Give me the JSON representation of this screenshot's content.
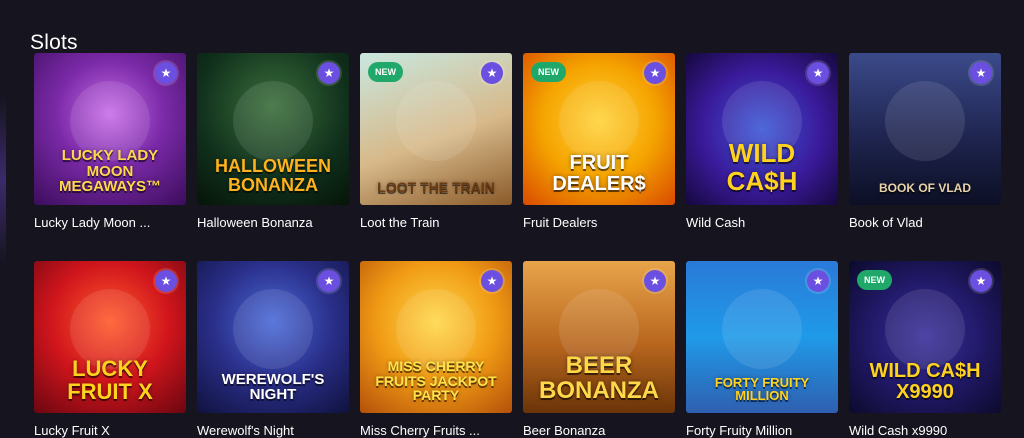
{
  "section": {
    "title": "Slots"
  },
  "games": [
    {
      "name": "Lucky Lady Moon ...",
      "art_text": "Lucky Lady Moon MEGAWAYS™",
      "new": false,
      "title_color": "#ffd84a"
    },
    {
      "name": "Halloween Bonanza",
      "art_text": "HALLOWEEN BONANZA",
      "new": false,
      "title_color": "#ffb21e"
    },
    {
      "name": "Loot the Train",
      "art_text": "Loot the Train",
      "new": true,
      "badge": "NEW",
      "title_color": "#6a3a12"
    },
    {
      "name": "Fruit Dealers",
      "art_text": "FRUIT DEALER$",
      "new": true,
      "badge": "NEW",
      "title_color": "#ffffff"
    },
    {
      "name": "Wild Cash",
      "art_text": "Wild CA$H",
      "new": false,
      "title_color": "#ffd21e"
    },
    {
      "name": "Book of Vlad",
      "art_text": "Book of Vlad",
      "new": false,
      "title_color": "#e8d2a8"
    },
    {
      "name": "Lucky Fruit X",
      "art_text": "LUCKY FRUIT X",
      "new": false,
      "title_color": "#ffd21e"
    },
    {
      "name": "Werewolf's Night",
      "art_text": "WEREWOLF'S NIGHT",
      "new": false,
      "title_color": "#ffffff"
    },
    {
      "name": "Miss Cherry Fruits ...",
      "art_text": "MISS CHERRY FRUITS JACKPOT PARTY",
      "new": false,
      "title_color": "#ffe24a"
    },
    {
      "name": "Beer Bonanza",
      "art_text": "BEER BONANZA",
      "new": false,
      "title_color": "#ffd84a"
    },
    {
      "name": "Forty Fruity Million",
      "art_text": "FORTY FRUITY MILLION",
      "new": false,
      "title_color": "#ffd21e"
    },
    {
      "name": "Wild Cash x9990",
      "art_text": "Wild CA$H x9990",
      "new": true,
      "badge": "NEW",
      "title_color": "#ffd21e"
    }
  ],
  "icons": {
    "favorite": "star-icon"
  },
  "colors": {
    "background": "#16141f",
    "favorite_badge": "#6b4fe0",
    "new_badge": "#1fa86a"
  }
}
